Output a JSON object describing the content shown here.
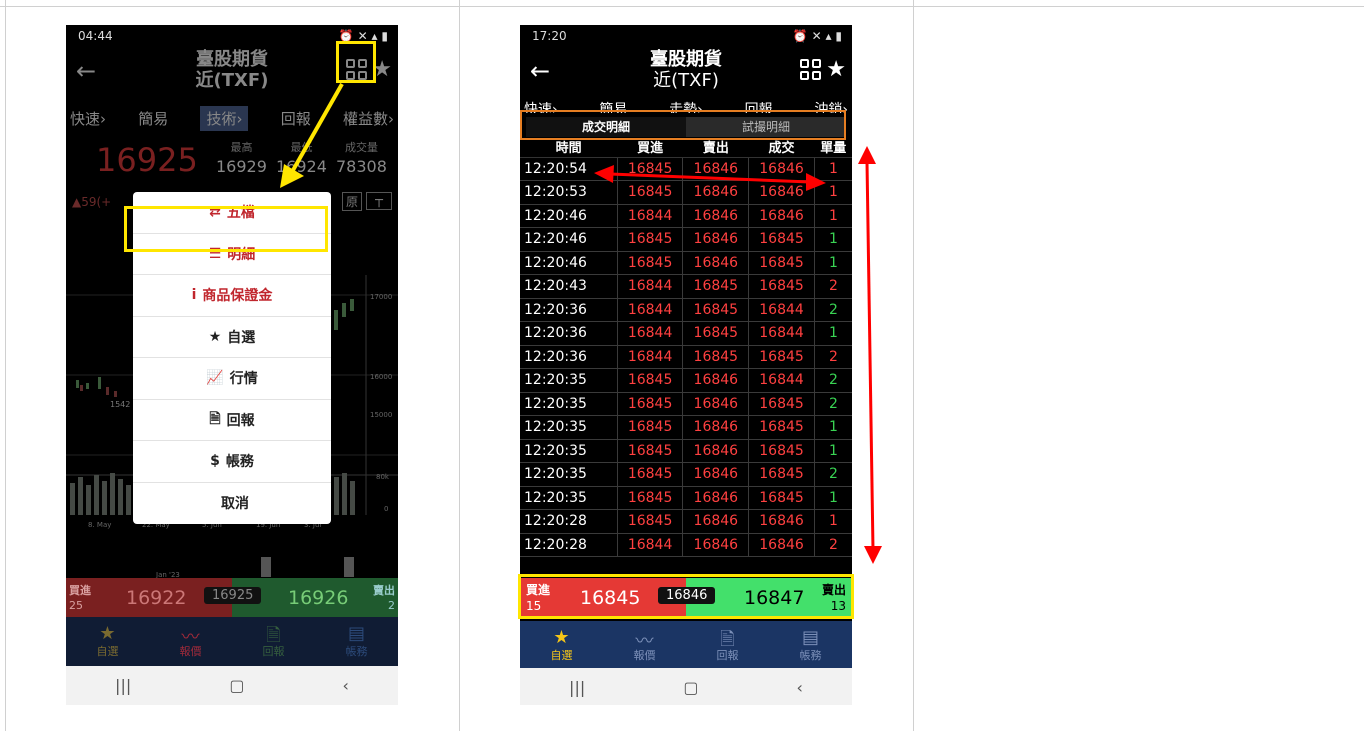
{
  "left_phone": {
    "status_time": "04:44",
    "title_line1": "臺股期貨",
    "title_line2": "近(TXF)",
    "tabs": [
      "快速›",
      "簡易",
      "技術›",
      "回報",
      "權益數›"
    ],
    "price": "16925",
    "change": "▲59(+",
    "stats": [
      {
        "label": "最高",
        "value": "16929"
      },
      {
        "label": "最低",
        "value": "16924"
      },
      {
        "label": "成交量",
        "value": "78308"
      }
    ],
    "restore_label": "原",
    "chart_axis": [
      "17000",
      "16000",
      "15000",
      "80k",
      "0"
    ],
    "chart_low_label": "1542",
    "date_labels": [
      "8. May",
      "22. May",
      "5. Jun",
      "19. Jun",
      "3. Jul"
    ],
    "nav_date": "Jan '23",
    "menu": [
      {
        "icon": "⇄",
        "label": "五檔",
        "red": true
      },
      {
        "icon": "☰",
        "label": "明細",
        "red": true
      },
      {
        "icon": "i",
        "label": "商品保證金",
        "red": true
      },
      {
        "icon": "★",
        "label": "自選",
        "red": false
      },
      {
        "icon": "📈",
        "label": "行情",
        "red": false
      },
      {
        "icon": "🗎",
        "label": "回報",
        "red": false
      },
      {
        "icon": "$",
        "label": "帳務",
        "red": false
      },
      {
        "icon": "",
        "label": "取消",
        "red": false
      }
    ],
    "trade": {
      "buy_label": "買進",
      "buy_qty": "25",
      "buy_price": "16922",
      "mid": "16925",
      "sell_price": "16926",
      "sell_label": "賣出",
      "sell_qty": "2"
    },
    "bottom_nav": [
      "自選",
      "報價",
      "回報",
      "帳務"
    ]
  },
  "right_phone": {
    "status_time": "17:20",
    "title_line1": "臺股期貨",
    "title_line2": "近(TXF)",
    "tabs": [
      "快速›",
      "簡易",
      "走勢›",
      "回報",
      "沖銷›"
    ],
    "subtabs": [
      "成交明細",
      "試撮明細"
    ],
    "columns": [
      "時間",
      "買進",
      "賣出",
      "成交",
      "單量"
    ],
    "rows": [
      [
        "12:20:54",
        "16845",
        "16846",
        "16846",
        "1"
      ],
      [
        "12:20:53",
        "16845",
        "16846",
        "16846",
        "1"
      ],
      [
        "12:20:46",
        "16844",
        "16846",
        "16846",
        "1"
      ],
      [
        "12:20:46",
        "16845",
        "16846",
        "16845",
        "1"
      ],
      [
        "12:20:46",
        "16845",
        "16846",
        "16845",
        "1"
      ],
      [
        "12:20:43",
        "16844",
        "16845",
        "16845",
        "2"
      ],
      [
        "12:20:36",
        "16844",
        "16845",
        "16844",
        "2"
      ],
      [
        "12:20:36",
        "16844",
        "16845",
        "16844",
        "1"
      ],
      [
        "12:20:36",
        "16844",
        "16845",
        "16845",
        "2"
      ],
      [
        "12:20:35",
        "16845",
        "16846",
        "16844",
        "2"
      ],
      [
        "12:20:35",
        "16845",
        "16846",
        "16845",
        "2"
      ],
      [
        "12:20:35",
        "16845",
        "16846",
        "16845",
        "1"
      ],
      [
        "12:20:35",
        "16845",
        "16846",
        "16845",
        "1"
      ],
      [
        "12:20:35",
        "16845",
        "16846",
        "16845",
        "2"
      ],
      [
        "12:20:35",
        "16845",
        "16846",
        "16845",
        "1"
      ],
      [
        "12:20:28",
        "16845",
        "16846",
        "16846",
        "1"
      ],
      [
        "12:20:28",
        "16844",
        "16846",
        "16846",
        "2"
      ]
    ],
    "qty_colors": [
      "r",
      "r",
      "r",
      "g",
      "g",
      "r",
      "g",
      "g",
      "r",
      "g",
      "g",
      "g",
      "g",
      "g",
      "g",
      "r",
      "r"
    ],
    "trade": {
      "buy_label": "買進",
      "buy_qty": "15",
      "buy_price": "16845",
      "mid": "16846",
      "sell_price": "16847",
      "sell_label": "賣出",
      "sell_qty": "13"
    },
    "bottom_nav": [
      "自選",
      "報價",
      "回報",
      "帳務"
    ]
  },
  "colors": {
    "highlight": "#ffe600",
    "arrow": "#ff0000",
    "buy": "#e53935",
    "sell": "#43e06b",
    "nav": "#1b3564"
  }
}
